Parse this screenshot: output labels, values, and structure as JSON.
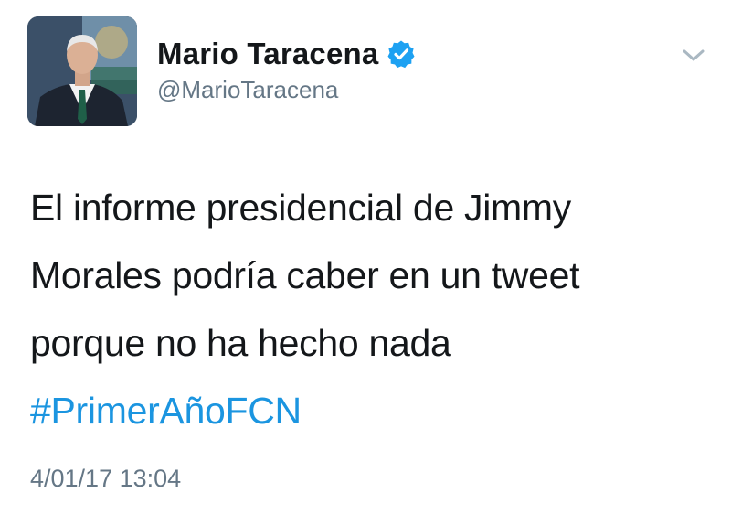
{
  "author": {
    "display_name": "Mario Taracena",
    "handle": "@MarioTaracena",
    "verified": true
  },
  "tweet": {
    "lines": [
      "El informe presidencial de Jimmy",
      "Morales podría caber en un tweet",
      "porque no ha hecho nada"
    ],
    "hashtag": "#PrimerAñoFCN",
    "timestamp": "4/01/17 13:04"
  },
  "colors": {
    "text": "#14171a",
    "secondary": "#657786",
    "link": "#1b95e0",
    "verified_badge": "#1da1f2"
  },
  "icons": {
    "verified": "verified-badge-icon",
    "menu": "chevron-down-icon"
  }
}
